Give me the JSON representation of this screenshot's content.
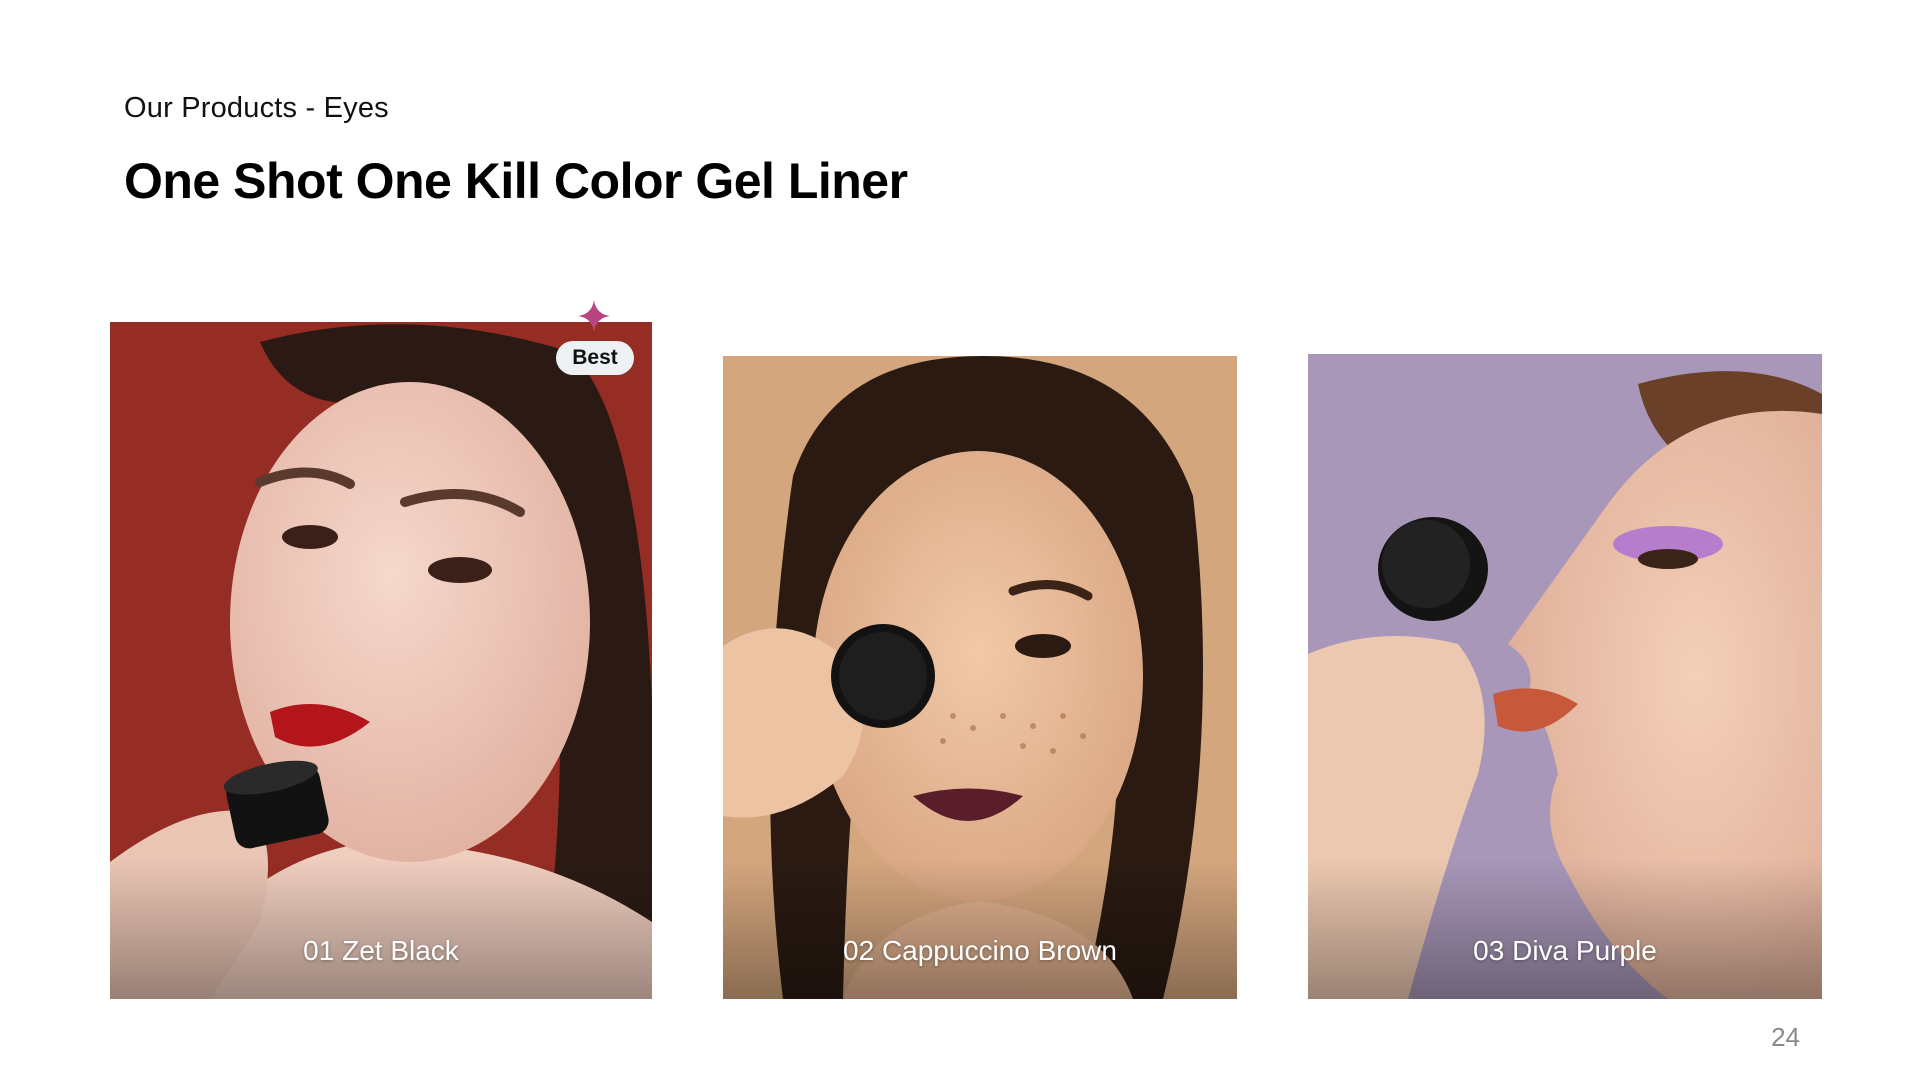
{
  "header": {
    "eyebrow": "Our Products - Eyes",
    "title": "One Shot One Kill Color Gel Liner"
  },
  "products": [
    {
      "label": "01 Zet Black",
      "badge": "Best",
      "background_color": "#9a2f26"
    },
    {
      "label": "02 Cappuccino Brown",
      "background_color": "#d4a67e"
    },
    {
      "label": "03 Diva Purple",
      "background_color": "#a897b8"
    }
  ],
  "footer": {
    "page_number": "24"
  },
  "colors": {
    "sparkle": "#b8457f",
    "badge_bg": "#eef1f4"
  }
}
